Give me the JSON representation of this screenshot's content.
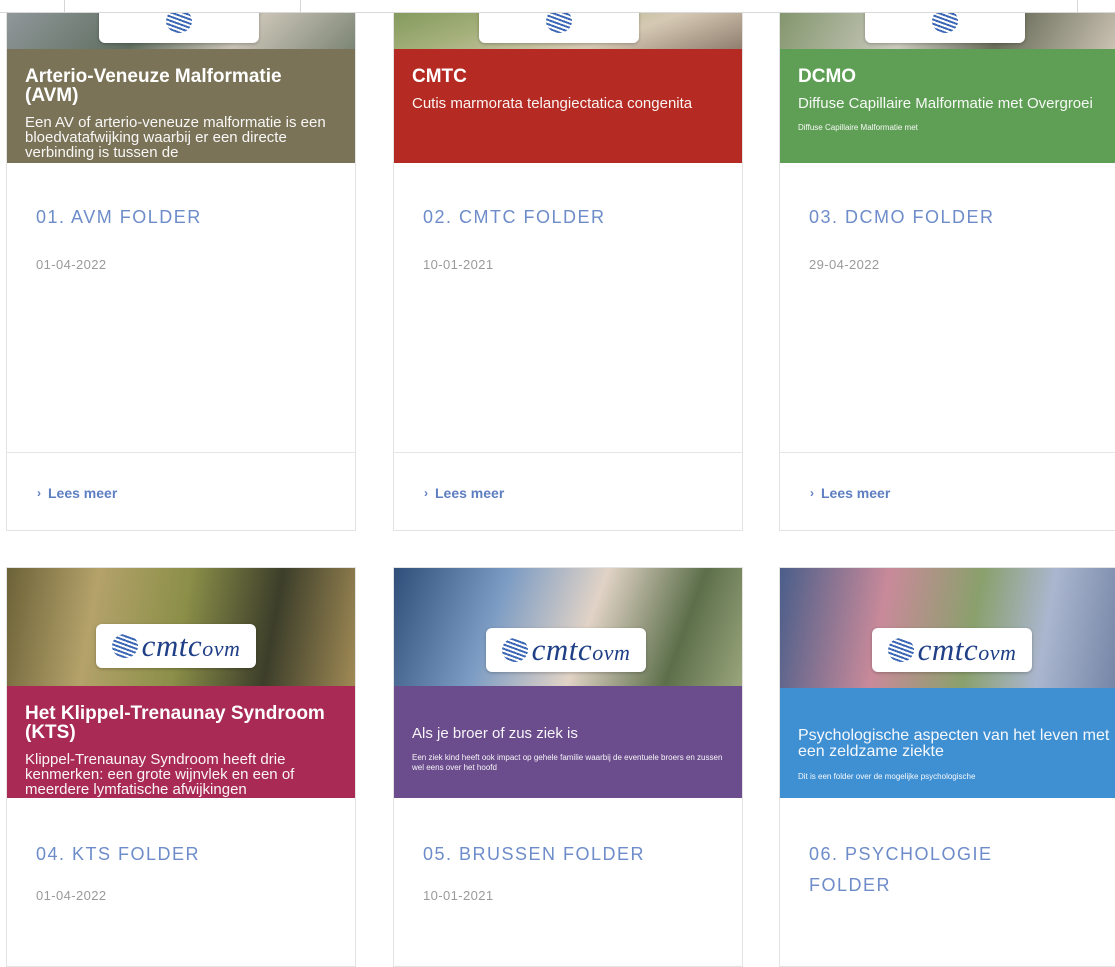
{
  "cards": [
    {
      "band_title": "Arterio-Veneuze Malformatie (AVM)",
      "band_subtitle": "Een AV of arterio-veneuze malformatie is een bloedvatafwijking waarbij er een directe verbinding is tussen de",
      "folder_title": "01. AVM FOLDER",
      "date": "01-04-2022",
      "link": "Lees meer",
      "band_color": "#7a7357"
    },
    {
      "band_title": "CMTC",
      "band_subtitle": "Cutis marmorata telangiectatica congenita",
      "folder_title": "02. CMTC FOLDER",
      "date": "10-01-2021",
      "link": "Lees meer",
      "band_color": "#b52a22"
    },
    {
      "band_title": "DCMO",
      "band_subtitle": "Diffuse Capillaire Malformatie met Overgroei",
      "band_extra": "Diffuse Capillaire Malformatie met",
      "folder_title": "03. DCMO FOLDER",
      "date": "29-04-2022",
      "link": "Lees meer",
      "band_color": "#5f9e55"
    },
    {
      "logo": "cmtc-ovm",
      "band_title": "Het Klippel-Trenaunay Syndroom (KTS)",
      "band_subtitle": "Klippel-Trenaunay Syndroom heeft drie kenmerken: een grote wijnvlek en een of meerdere lymfatische afwijkingen",
      "folder_title": "04. KTS FOLDER",
      "date": "01-04-2022",
      "band_color": "#a82a55"
    },
    {
      "logo": "cmtc-ovm",
      "band_title": "Als je broer of zus ziek is",
      "band_subtitle": "Een ziek kind heeft ook impact op gehele familie waarbij de eventuele broers en zussen wel eens over het hoofd",
      "folder_title": "05. BRUSSEN FOLDER",
      "date": "10-01-2021",
      "band_color": "#6b4c8c"
    },
    {
      "logo": "cmtc-ovm",
      "band_title": "Psychologische aspecten van het leven met een zeldzame ziekte",
      "band_subtitle": "Dit is een folder over de mogelijke psychologische",
      "folder_title": "06. PSYCHOLOGIE FOLDER",
      "band_color": "#3f8fd3"
    }
  ]
}
